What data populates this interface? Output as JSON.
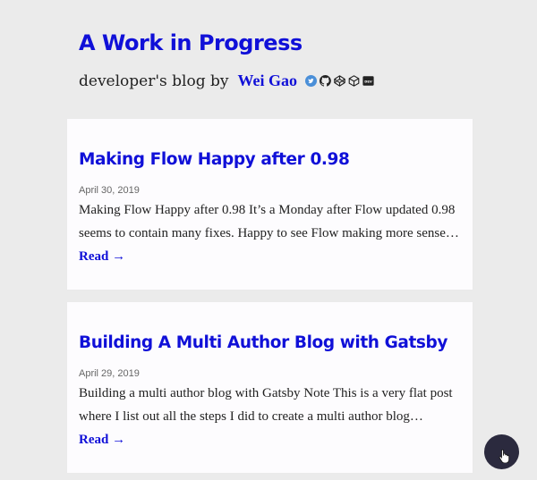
{
  "header": {
    "site_title": "A Work in Progress",
    "tagline": "developer's blog by",
    "author": "Wei Gao",
    "social_icons": [
      "twitter-icon",
      "github-icon",
      "codepen-icon",
      "codesandbox-icon",
      "dev-icon"
    ],
    "dev_badge": "DEV"
  },
  "posts": [
    {
      "title": "Making Flow Happy after 0.98",
      "date": "April 30, 2019",
      "excerpt": "Making Flow Happy after 0.98 It’s a Monday after Flow updated 0.98 seems to contain many fixes. Happy to see Flow making more sense…",
      "read_label": "Read →"
    },
    {
      "title": "Building A Multi Author Blog with Gatsby",
      "date": "April 29, 2019",
      "excerpt": "Building a multi author blog with Gatsby Note This is a very flat post where I list out all the steps I did to create a multi author blog…",
      "read_label": "Read →"
    }
  ],
  "fab": {
    "icon": "hand-pointer-icon"
  },
  "colors": {
    "accent": "#1010d8",
    "background": "#ebebeb",
    "card": "#fdfcfe",
    "fab": "#2b2a3e"
  }
}
